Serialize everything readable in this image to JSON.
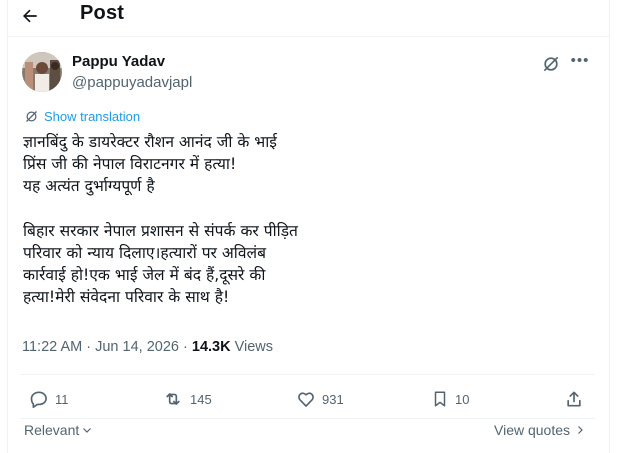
{
  "header": {
    "title": "Post"
  },
  "author": {
    "name": "Pappu Yadav",
    "handle": "@pappuyadavjapl"
  },
  "translation": {
    "label": "Show translation"
  },
  "tweet": {
    "text": "ज्ञानबिंदु के डायरेक्टर रौशन आनंद जी के भाई\nप्रिंस जी की नेपाल विराटनगर में हत्या!\nयह अत्यंत दुर्भाग्यपूर्ण है\n\nबिहार सरकार नेपाल प्रशासन से संपर्क कर पीड़ित\nपरिवार को न्याय दिलाए।हत्यारों पर अविलंब\nकार्रवाई हो!एक भाई जेल में बंद हैं,दूसरे की\nहत्या!मेरी संवेदना परिवार के साथ है!"
  },
  "meta": {
    "time": "11:22 AM",
    "separator": "·",
    "date": "Jun 14, 2026",
    "separator2": "·",
    "views": "14.3K",
    "views_label": "Views"
  },
  "actions": {
    "replies": "11",
    "reposts": "145",
    "likes": "931",
    "bookmarks": "10"
  },
  "footer": {
    "sort_label": "Relevant",
    "view_quotes": "View quotes"
  },
  "icons": [
    "back-arrow-icon",
    "grok-icon",
    "more-icon",
    "translate-icon",
    "reply-icon",
    "repost-icon",
    "like-icon",
    "bookmark-icon",
    "share-icon",
    "chevron-down-icon",
    "chevron-right-icon"
  ]
}
